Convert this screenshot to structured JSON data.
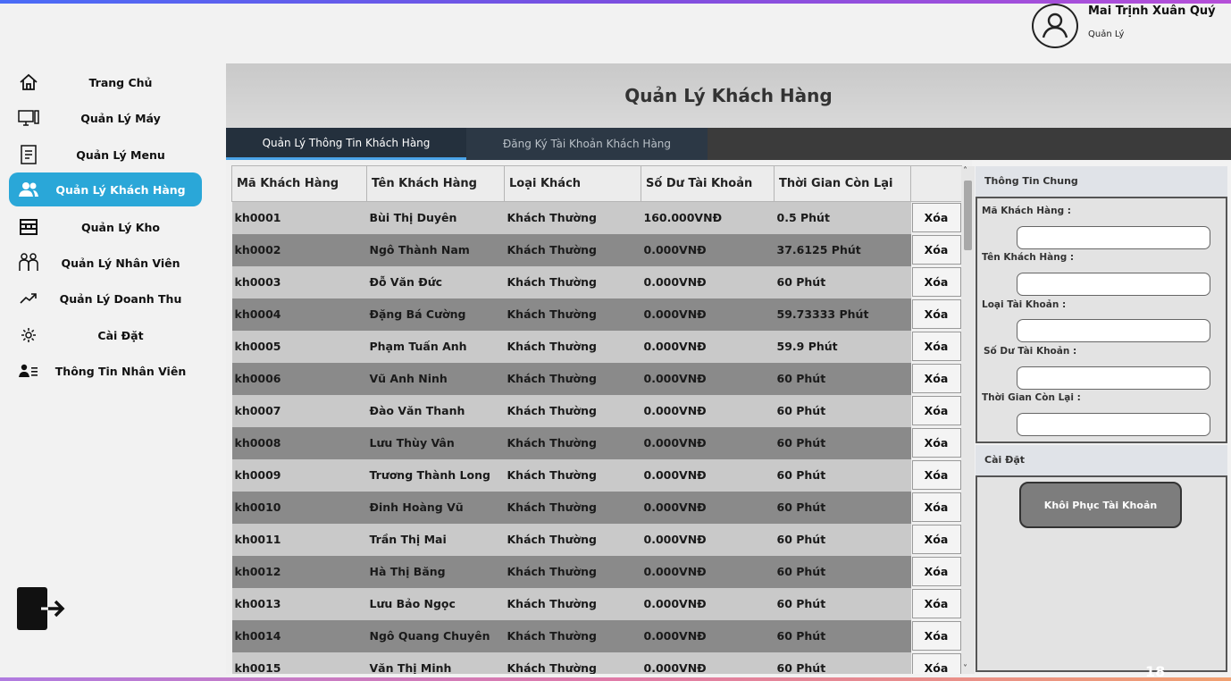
{
  "user": {
    "name": "Mai Trịnh Xuân Quý",
    "role": "Quản Lý"
  },
  "sidebar": {
    "items": [
      {
        "label": "Trang Chủ",
        "icon": "home-icon"
      },
      {
        "label": "Quản Lý Máy",
        "icon": "computer-icon"
      },
      {
        "label": "Quản Lý Menu",
        "icon": "menu-document-icon"
      },
      {
        "label": "Quản Lý Khách Hàng",
        "icon": "users-icon",
        "active": true
      },
      {
        "label": "Quản Lý Kho",
        "icon": "store-icon"
      },
      {
        "label": "Quản Lý Nhân Viên",
        "icon": "staff-icon"
      },
      {
        "label": "Quản Lý Doanh Thu",
        "icon": "trend-up-icon"
      },
      {
        "label": "Cài Đặt",
        "icon": "gear-icon"
      },
      {
        "label": "Thông Tin Nhân Viên",
        "icon": "user-list-icon"
      }
    ],
    "logout_icon": "logout-icon"
  },
  "main": {
    "title": "Quản Lý Khách Hàng",
    "tabs": [
      {
        "label": "Quản Lý Thông Tin Khách Hàng",
        "active": true
      },
      {
        "label": "Đăng Ký Tài Khoản Khách Hàng",
        "active": false
      }
    ]
  },
  "table": {
    "columns": [
      "Mã Khách Hàng",
      "Tên Khách Hàng",
      "Loại Khách",
      "Số Dư Tài Khoản",
      "Thời Gian Còn Lại"
    ],
    "delete_label": "Xóa",
    "rows": [
      [
        "kh0001",
        "Bùi Thị Duyên",
        "Khách Thường",
        "160.000VNĐ",
        "0.5 Phút"
      ],
      [
        "kh0002",
        "Ngô Thành Nam",
        "Khách Thường",
        "0.000VNĐ",
        "37.6125 Phút"
      ],
      [
        "kh0003",
        "Đỗ Văn Đức",
        "Khách Thường",
        "0.000VNĐ",
        "60 Phút"
      ],
      [
        "kh0004",
        "Đặng Bá Cường",
        "Khách Thường",
        "0.000VNĐ",
        "59.73333 Phút"
      ],
      [
        "kh0005",
        "Phạm Tuấn Anh",
        "Khách Thường",
        "0.000VNĐ",
        "59.9 Phút"
      ],
      [
        "kh0006",
        "Vũ Anh Ninh",
        "Khách Thường",
        "0.000VNĐ",
        "60 Phút"
      ],
      [
        "kh0007",
        "Đào Văn Thanh",
        "Khách Thường",
        "0.000VNĐ",
        "60 Phút"
      ],
      [
        "kh0008",
        "Lưu Thùy Vân",
        "Khách Thường",
        "0.000VNĐ",
        "60 Phút"
      ],
      [
        "kh0009",
        "Trương Thành Long",
        "Khách Thường",
        "0.000VNĐ",
        "60 Phút"
      ],
      [
        "kh0010",
        "Đinh Hoàng Vũ",
        "Khách Thường",
        "0.000VNĐ",
        "60 Phút"
      ],
      [
        "kh0011",
        "Trần Thị Mai",
        "Khách Thường",
        "0.000VNĐ",
        "60 Phút"
      ],
      [
        "kh0012",
        "Hà Thị Băng",
        "Khách Thường",
        "0.000VNĐ",
        "60 Phút"
      ],
      [
        "kh0013",
        "Lưu Bảo Ngọc",
        "Khách Thường",
        "0.000VNĐ",
        "60 Phút"
      ],
      [
        "kh0014",
        "Ngô Quang Chuyên",
        "Khách Thường",
        "0.000VNĐ",
        "60 Phút"
      ],
      [
        "kh0015",
        "Văn Thị Minh",
        "Khách Thường",
        "0.000VNĐ",
        "60 Phút"
      ]
    ]
  },
  "panel": {
    "general_title": "Thông Tin Chung",
    "fields": [
      {
        "label": "Mã Khách Hàng :",
        "value": ""
      },
      {
        "label": "Tên Khách Hàng :",
        "value": ""
      },
      {
        "label": "Loại Tài Khoản :",
        "value": ""
      },
      {
        "label": "Số Dư Tài Khoản :",
        "value": ""
      },
      {
        "label": "Thời Gian Còn Lại :",
        "value": ""
      }
    ],
    "settings_title": "Cài Đặt",
    "restore_label": "Khôi Phục Tài Khoản"
  },
  "page_number": "18",
  "colors": {
    "active_nav": "#2aa7d8",
    "tab_active": "#24303d",
    "tab_underline": "#4aa3e8"
  }
}
